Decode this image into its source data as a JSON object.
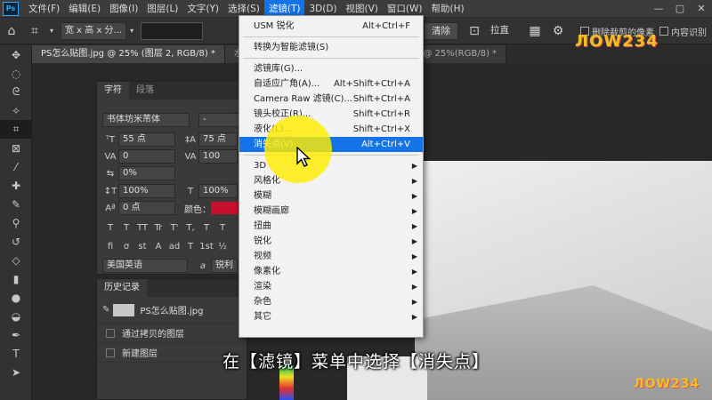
{
  "app": {
    "logo": "Ps"
  },
  "menubar": {
    "items": [
      "文件(F)",
      "编辑(E)",
      "图像(I)",
      "图层(L)",
      "文字(Y)",
      "选择(S)",
      "滤镜(T)",
      "3D(D)",
      "视图(V)",
      "窗口(W)",
      "帮助(H)"
    ],
    "active_index": 6
  },
  "optbar": {
    "crop_ratio": "宽 x 高 x 分...",
    "clear_button": "清除",
    "straighten_button": "拉直",
    "delete_cropped_pixels": "删除裁剪的像素",
    "content_aware": "内容识别"
  },
  "tabs": [
    "PS怎么贴图.jpg @ 25% (图层 2, RGB/8) *",
    "水墨...",
    ".jpg @ 25%(RGB/8) *"
  ],
  "char_panel": {
    "tabs": [
      "字符",
      "段落"
    ],
    "font_family": "书体坊米芾体",
    "font_style": "-",
    "font_size": "55 点",
    "leading": "75 点",
    "kerning": "0",
    "tracking": "100",
    "tsume": "0%",
    "vertical_scale": "100%",
    "horizontal_scale": "100%",
    "baseline_shift": "0 点",
    "color_label": "颜色：",
    "color_value": "#c8102e",
    "type_style_buttons": [
      "T",
      "T",
      "TT",
      "Tr",
      "T'",
      "T,",
      "T",
      "T"
    ],
    "opentype_buttons": [
      "fi",
      "σ",
      "st",
      "A",
      "ad",
      "T",
      "1st",
      "½"
    ],
    "language": "美国英语",
    "antialias_label": "a",
    "antialias": "锐利"
  },
  "history_panel": {
    "title": "历史记录",
    "snapshot": "PS怎么贴图.jpg",
    "items": [
      "通过拷贝的图层",
      "新建图层"
    ]
  },
  "filter_menu": {
    "items": [
      {
        "label": "USM 锐化",
        "shortcut": "Alt+Ctrl+F",
        "submenu": false
      },
      {
        "sep": true
      },
      {
        "label": "转换为智能滤镜(S)",
        "shortcut": "",
        "submenu": false
      },
      {
        "sep": true
      },
      {
        "label": "滤镜库(G)...",
        "shortcut": "",
        "submenu": false
      },
      {
        "label": "自适应广角(A)...",
        "shortcut": "Alt+Shift+Ctrl+A",
        "submenu": false
      },
      {
        "label": "Camera Raw 滤镜(C)...",
        "shortcut": "Shift+Ctrl+A",
        "submenu": false
      },
      {
        "label": "镜头校正(R)...",
        "shortcut": "Shift+Ctrl+R",
        "submenu": false
      },
      {
        "label": "液化(L)...",
        "shortcut": "Shift+Ctrl+X",
        "submenu": false
      },
      {
        "label": "消失点(V)...",
        "shortcut": "Alt+Ctrl+V",
        "submenu": false,
        "highlighted": true
      },
      {
        "sep": true
      },
      {
        "label": "3D",
        "shortcut": "",
        "submenu": true
      },
      {
        "label": "风格化",
        "shortcut": "",
        "submenu": true
      },
      {
        "label": "模糊",
        "shortcut": "",
        "submenu": true
      },
      {
        "label": "模糊画廊",
        "shortcut": "",
        "submenu": true
      },
      {
        "label": "扭曲",
        "shortcut": "",
        "submenu": true
      },
      {
        "label": "锐化",
        "shortcut": "",
        "submenu": true
      },
      {
        "label": "视频",
        "shortcut": "",
        "submenu": true
      },
      {
        "label": "像素化",
        "shortcut": "",
        "submenu": true
      },
      {
        "label": "渲染",
        "shortcut": "",
        "submenu": true
      },
      {
        "label": "杂色",
        "shortcut": "",
        "submenu": true
      },
      {
        "label": "其它",
        "shortcut": "",
        "submenu": true
      }
    ]
  },
  "subtitle": "在【滤镜】菜单中选择【消失点】",
  "watermark": "ЛOW234",
  "colors": {
    "menu_highlight": "#1473e6",
    "cursor_halo": "#ffeb00"
  }
}
